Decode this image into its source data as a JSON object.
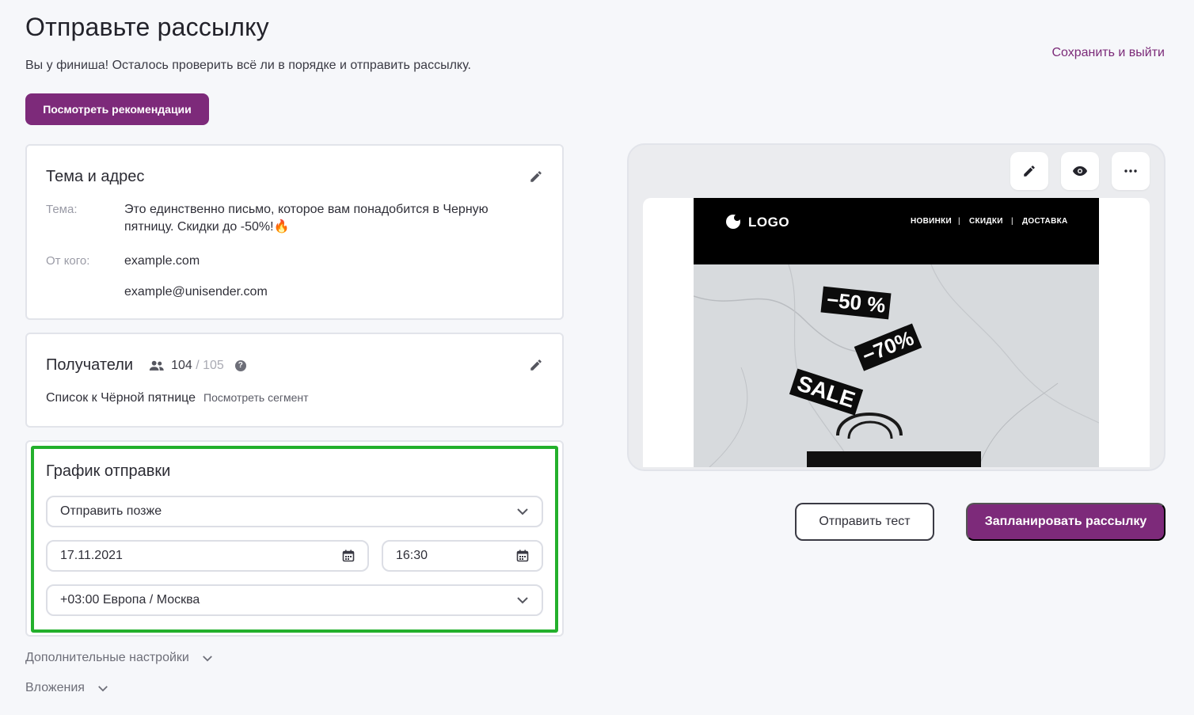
{
  "page": {
    "title": "Отправьте рассылку",
    "subtitle": "Вы у финиша! Осталось проверить всё ли в порядке и отправить рассылку.",
    "save_exit": "Сохранить и выйти",
    "recommendations_button": "Посмотреть рекомендации"
  },
  "subject_card": {
    "title": "Тема и адрес",
    "subject_label": "Тема:",
    "subject_line1": "Это единственно письмо, которое вам понадобится в Черную",
    "subject_line2": "пятницу. Скидки до -50%!🔥",
    "from_label": "От кого:",
    "from_name": "example.com",
    "from_email": "example@unisender.com"
  },
  "recipients_card": {
    "title": "Получатели",
    "count": "104",
    "total": " / 105",
    "help": "?",
    "list_name": "Список к Чёрной пятнице",
    "segment_link": "Посмотреть сегмент"
  },
  "schedule_card": {
    "title": "График отправки",
    "mode": "Отправить позже",
    "date": "17.11.2021",
    "time": "16:30",
    "timezone": "+03:00 Европа / Москва"
  },
  "expanders": {
    "additional": "Дополнительные настройки",
    "attachments": "Вложения"
  },
  "preview": {
    "logo": "LOGO",
    "nav_new": "НОВИНКИ",
    "nav_sep": "|",
    "nav_sale": "СКИДКИ",
    "nav_delivery": "ДОСТАВКА",
    "tag_50": "−50 %",
    "tag_70": "−70%",
    "tag_sale": "SALE"
  },
  "actions": {
    "send_test": "Отправить тест",
    "schedule": "Запланировать рассылку"
  },
  "colors": {
    "accent": "#7d2a7a",
    "highlight": "#23b02c"
  },
  "icons": [
    "pencil-icon",
    "eye-icon",
    "more-icon",
    "users-icon",
    "help-icon",
    "calendar-icon",
    "chevron-down-icon"
  ]
}
